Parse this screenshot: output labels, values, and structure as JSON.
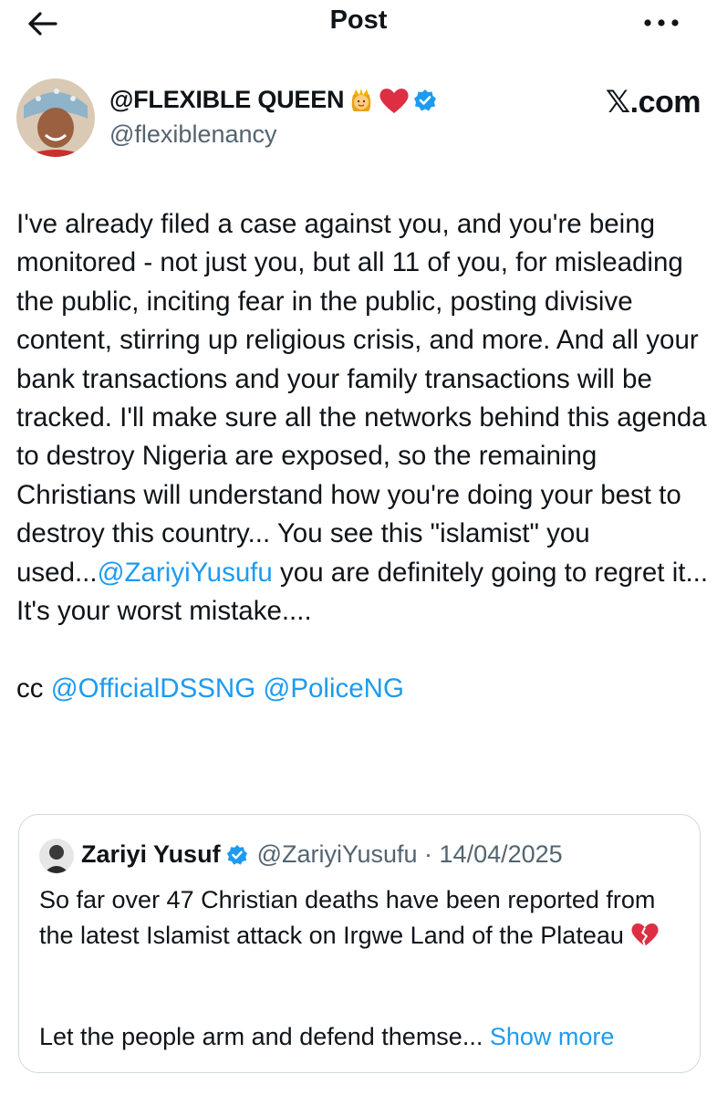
{
  "header": {
    "title": "Post",
    "back_icon": "arrow-left-icon",
    "more_icon": "more-horizontal-icon"
  },
  "author": {
    "display_name": "@FLEXIBLE QUEEN",
    "emojis": [
      "princess-emoji-icon",
      "red-heart-emoji-icon"
    ],
    "verified_icon": "verified-badge-icon",
    "handle": "@flexiblenancy",
    "watermark": "𝕏.com"
  },
  "post": {
    "text_before_mention": "I've already filed a case against you, and you're being monitored - not just you, but all 11 of you, for misleading the public, inciting fear in the public, posting divisive content, stirring up religious crisis, and more. And all your bank transactions and your family transactions will be tracked. I'll make sure all the networks behind this agenda to destroy Nigeria are exposed, so the remaining Christians will understand how you're doing your best to destroy this country... You see this \"islamist\" you used...",
    "mention_1": "@ZariyiYusufu",
    "text_after_mention": " you are definitely going to regret it... It's your worst mistake....",
    "cc_label": "cc ",
    "mention_2": "@OfficialDSSNG",
    "mention_3": "@PoliceNG"
  },
  "quoted_post": {
    "display_name": "Zariyi Yusuf",
    "verified_icon": "verified-badge-icon",
    "meta": "@ZariyiYusufu · 14/04/2025",
    "text": "So far over 47 Christian deaths have been reported from the latest Islamist attack on Irgwe Land of the Plateau",
    "emoji": "broken-heart-emoji-icon",
    "text_2": "Let the people arm and defend themse...",
    "show_more": "Show more"
  },
  "colors": {
    "accent": "#1d9bf0",
    "text": "#0f1419",
    "secondary": "#536471",
    "border": "#cfd9de"
  }
}
